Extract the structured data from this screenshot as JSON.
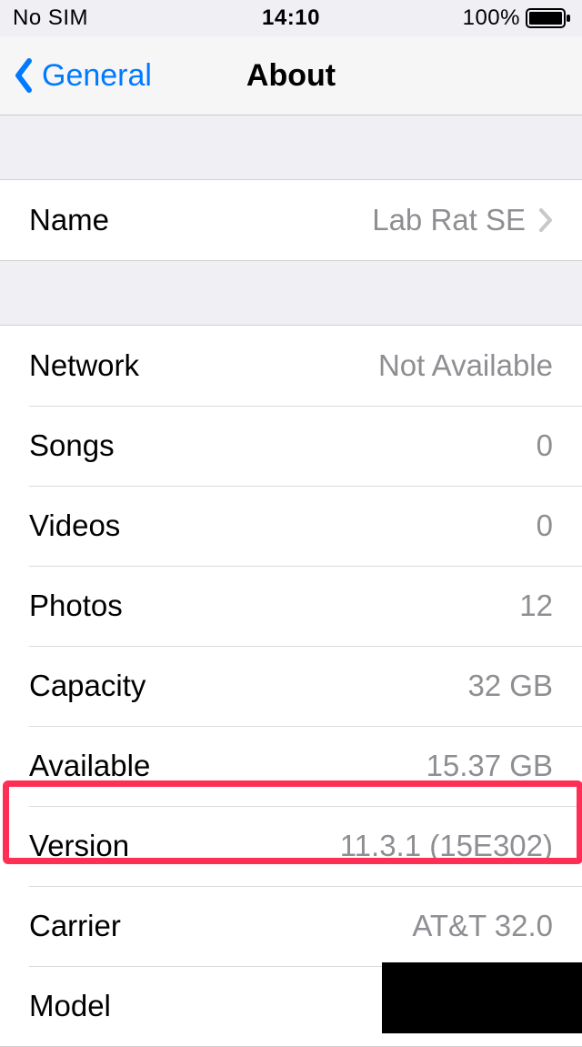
{
  "status": {
    "carrier": "No SIM",
    "time": "14:10",
    "battery_pct": "100%"
  },
  "nav": {
    "back_label": "General",
    "title": "About"
  },
  "name_row": {
    "label": "Name",
    "value": "Lab Rat SE"
  },
  "rows": [
    {
      "label": "Network",
      "value": "Not Available"
    },
    {
      "label": "Songs",
      "value": "0"
    },
    {
      "label": "Videos",
      "value": "0"
    },
    {
      "label": "Photos",
      "value": "12"
    },
    {
      "label": "Capacity",
      "value": "32 GB"
    },
    {
      "label": "Available",
      "value": "15.37 GB"
    },
    {
      "label": "Version",
      "value": "11.3.1 (15E302)"
    },
    {
      "label": "Carrier",
      "value": "AT&T 32.0"
    },
    {
      "label": "Model",
      "value": ""
    }
  ]
}
